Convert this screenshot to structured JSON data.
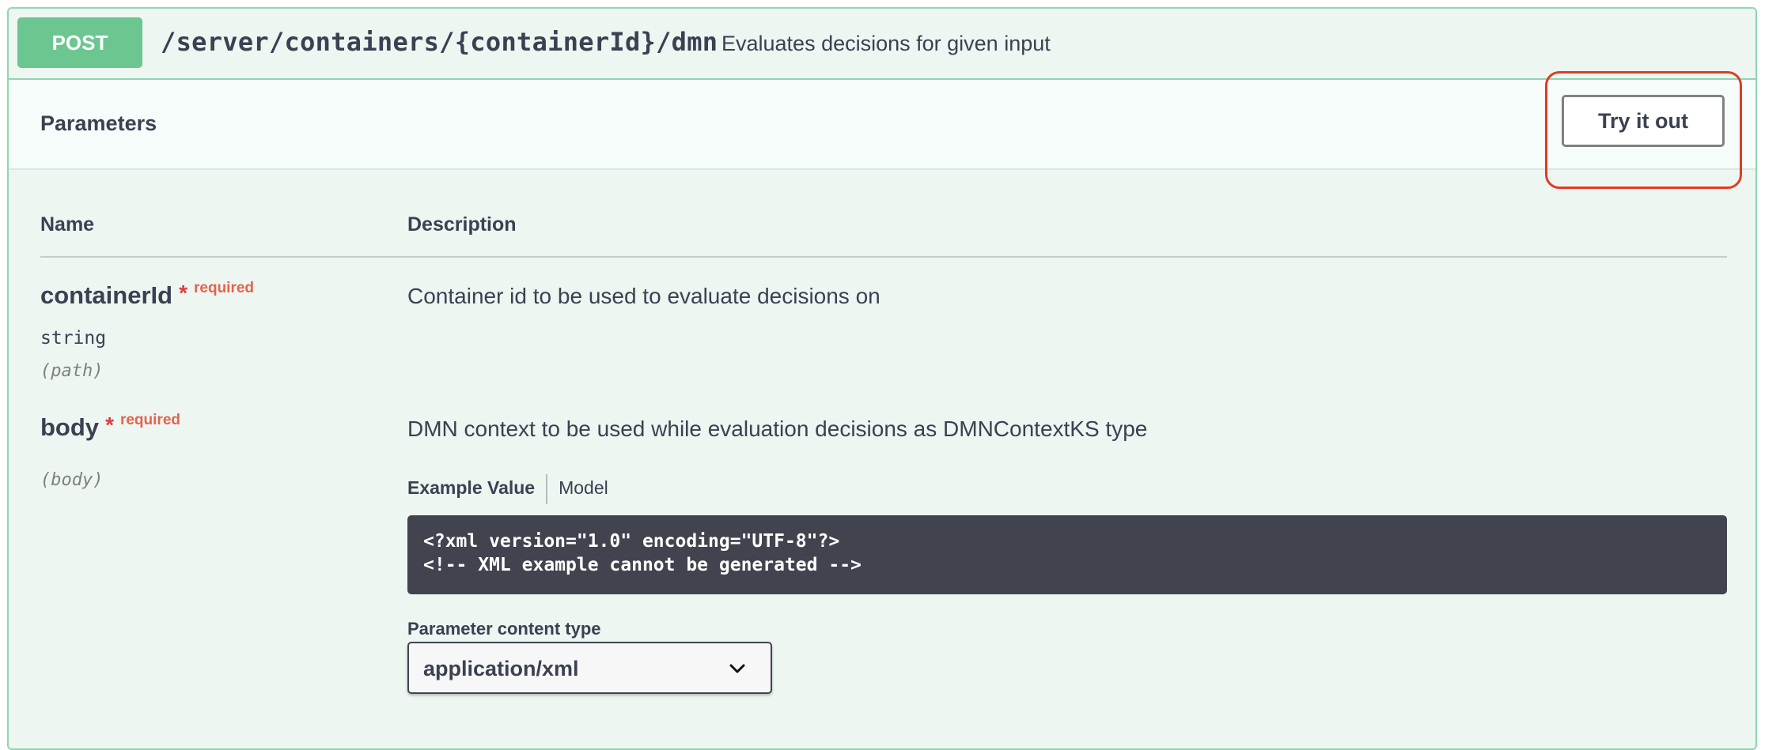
{
  "operation": {
    "method": "POST",
    "path": "/server/containers/{containerId}/dmn",
    "summary": "Evaluates decisions for given input"
  },
  "parameters_section": {
    "title": "Parameters",
    "try_button_label": "Try it out"
  },
  "table": {
    "name_header": "Name",
    "description_header": "Description"
  },
  "params": [
    {
      "name": "containerId",
      "required_star": "*",
      "required_label": "required",
      "type": "string",
      "location": "(path)",
      "description": "Container id to be used to evaluate decisions on"
    },
    {
      "name": "body",
      "required_star": "*",
      "required_label": "required",
      "location": "(body)",
      "description": "DMN context to be used while evaluation decisions as DMNContextKS type"
    }
  ],
  "example": {
    "tab_example": "Example Value",
    "tab_model": "Model",
    "code_line_1": "<?xml version=\"1.0\" encoding=\"UTF-8\"?>",
    "code_line_2": "<!-- XML example cannot be generated -->"
  },
  "content_type": {
    "label": "Parameter content type",
    "selected": "application/xml"
  },
  "icons": {
    "dropdown": "chevron-down-icon"
  },
  "colors": {
    "method_post": "#6bc690",
    "panel_border": "#8fd6b0",
    "panel_bg": "#edf6f1",
    "required": "#e5634a",
    "highlight": "#e33a24",
    "code_bg": "#41444e"
  }
}
